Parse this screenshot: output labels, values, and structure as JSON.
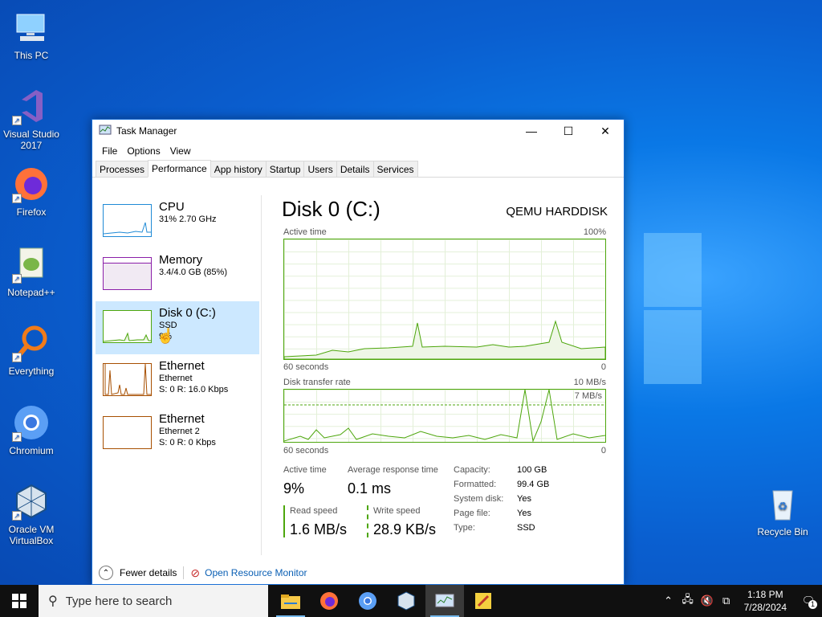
{
  "desktop": {
    "icons": [
      {
        "label": "This PC",
        "icon": "this-pc-icon"
      },
      {
        "label": "Visual Studio 2017",
        "icon": "visual-studio-icon"
      },
      {
        "label": "Firefox",
        "icon": "firefox-icon"
      },
      {
        "label": "Notepad++",
        "icon": "notepadpp-icon"
      },
      {
        "label": "Everything",
        "icon": "everything-icon"
      },
      {
        "label": "Chromium",
        "icon": "chromium-icon"
      },
      {
        "label": "Oracle VM VirtualBox",
        "icon": "virtualbox-icon"
      },
      {
        "label": "Recycle Bin",
        "icon": "recycle-bin-icon"
      }
    ]
  },
  "window": {
    "title": "Task Manager",
    "menu": [
      "File",
      "Options",
      "View"
    ],
    "tabs": [
      "Processes",
      "Performance",
      "App history",
      "Startup",
      "Users",
      "Details",
      "Services"
    ],
    "active_tab": "Performance"
  },
  "sidebar": {
    "items": [
      {
        "name": "CPU",
        "sub1": "31%  2.70 GHz",
        "sub2": "",
        "color": "#1f8ad6"
      },
      {
        "name": "Memory",
        "sub1": "3.4/4.0 GB (85%)",
        "sub2": "",
        "color": "#8b1fa9"
      },
      {
        "name": "Disk 0 (C:)",
        "sub1": "SSD",
        "sub2": "9%",
        "color": "#4da60c"
      },
      {
        "name": "Ethernet",
        "sub1": "Ethernet",
        "sub2": "S: 0 R: 16.0 Kbps",
        "color": "#a74f01"
      },
      {
        "name": "Ethernet",
        "sub1": "Ethernet 2",
        "sub2": "S: 0 R: 0 Kbps",
        "color": "#a74f01"
      }
    ]
  },
  "main": {
    "title": "Disk 0 (C:)",
    "model": "QEMU HARDDISK",
    "graph1": {
      "label": "Active time",
      "max": "100%",
      "time": "60 seconds",
      "min": "0"
    },
    "graph2": {
      "label": "Disk transfer rate",
      "max": "10 MB/s",
      "inner": "7 MB/s",
      "time": "60 seconds",
      "min": "0"
    },
    "stats": {
      "active_time_label": "Active time",
      "active_time": "9%",
      "avg_resp_label": "Average response time",
      "avg_resp": "0.1 ms",
      "read_label": "Read speed",
      "read": "1.6 MB/s",
      "write_label": "Write speed",
      "write": "28.9 KB/s"
    },
    "props": [
      [
        "Capacity:",
        "100 GB"
      ],
      [
        "Formatted:",
        "99.4 GB"
      ],
      [
        "System disk:",
        "Yes"
      ],
      [
        "Page file:",
        "Yes"
      ],
      [
        "Type:",
        "SSD"
      ]
    ]
  },
  "footer": {
    "fewer": "Fewer details",
    "monitor": "Open Resource Monitor"
  },
  "taskbar": {
    "search": "Type here to search",
    "time": "1:18 PM",
    "date": "7/28/2024",
    "notif_count": "1"
  }
}
